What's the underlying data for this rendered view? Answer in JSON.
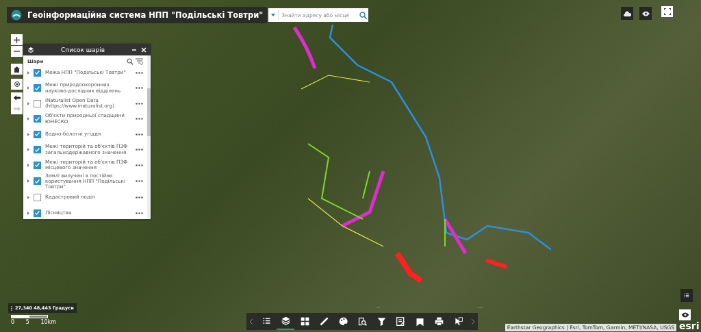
{
  "header": {
    "title": "Геоінформаційна система НПП \"Подільські Товтри\""
  },
  "search": {
    "placeholder": "Знайти адресу або місце"
  },
  "layer_panel": {
    "title": "Список шарів",
    "heading": "Шари",
    "layers": [
      {
        "label": "Межа НПП \"Подільські Товтри\"",
        "checked": true
      },
      {
        "label": "Межі природоохоронних науково-дослідних відділень",
        "checked": true
      },
      {
        "label": "iNaturalist Open Data (https://www.inaturalist.org)",
        "checked": false
      },
      {
        "label": "Об'єкти природньої спадщини ЮНЕСКО",
        "checked": true
      },
      {
        "label": "Водно-болотні угіддя",
        "checked": true
      },
      {
        "label": "Межі територій та об'єктів ПЗФ загальнодержавного значення",
        "checked": true
      },
      {
        "label": "Межі територій та об'єктів ПЗФ місцевого значення",
        "checked": true
      },
      {
        "label": "Землі вилучені в постійне користування НПП \"Подільські Товтри\"",
        "checked": true
      },
      {
        "label": "Кадастровий поділ",
        "checked": false
      },
      {
        "label": "Лісництва",
        "checked": true
      }
    ]
  },
  "coordinates": "27,340 48,443 Градуси",
  "scale_labels": [
    "0",
    "5",
    "10km"
  ],
  "toolbar": {
    "tools": [
      {
        "kind": "list",
        "selected": false
      },
      {
        "kind": "layers",
        "selected": true
      },
      {
        "kind": "basemap",
        "selected": false
      },
      {
        "kind": "measure",
        "selected": false
      },
      {
        "kind": "palette",
        "selected": false
      },
      {
        "kind": "query",
        "selected": false
      },
      {
        "kind": "filter",
        "selected": false
      },
      {
        "kind": "edit",
        "selected": false
      },
      {
        "kind": "bookmark",
        "selected": false
      },
      {
        "kind": "print",
        "selected": false
      },
      {
        "kind": "select",
        "selected": false
      }
    ]
  },
  "attribution": "Earthstar Geographics | Esri, TomTom, Garmin, METI/NASA, USGS",
  "logo": "esri"
}
